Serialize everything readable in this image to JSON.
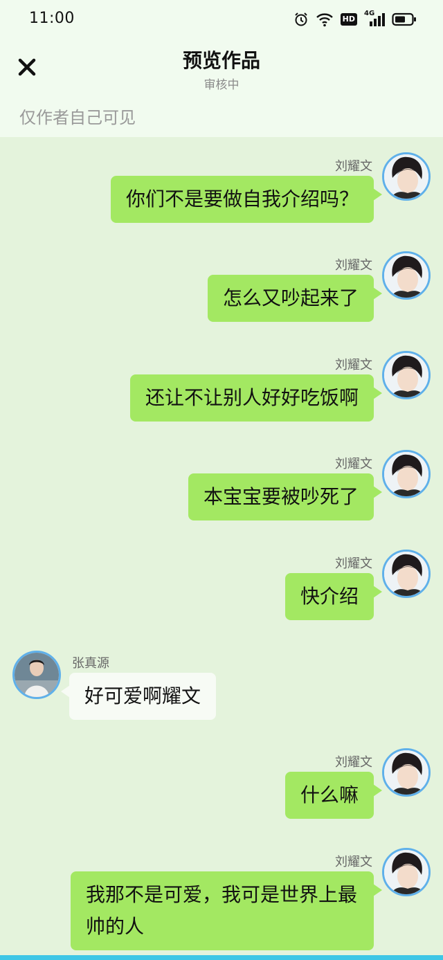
{
  "status_bar": {
    "time": "11:00",
    "icons": [
      "alarm-icon",
      "wifi-icon",
      "hd-icon",
      "signal-4g-icon",
      "battery-icon"
    ],
    "hd_label": "HD",
    "network_label": "4G"
  },
  "header": {
    "close_icon": "close-icon",
    "title": "预览作品",
    "subtitle": "审核中"
  },
  "visibility_note": "仅作者自己可见",
  "colors": {
    "background": "#e4f3dc",
    "header_bg": "#f1fbef",
    "sent_bubble": "#a3e862",
    "received_bubble": "#f7fbf5",
    "avatar_ring": "#5fb0ea",
    "bottom_bar": "#3ec6e6"
  },
  "messages": [
    {
      "side": "right",
      "sender": "刘耀文",
      "text": "你们不是要做自我介绍吗？"
    },
    {
      "side": "right",
      "sender": "刘耀文",
      "text": "怎么又吵起来了"
    },
    {
      "side": "right",
      "sender": "刘耀文",
      "text": "还让不让别人好好吃饭啊"
    },
    {
      "side": "right",
      "sender": "刘耀文",
      "text": "本宝宝要被吵死了"
    },
    {
      "side": "right",
      "sender": "刘耀文",
      "text": "快介绍"
    },
    {
      "side": "left",
      "sender": "张真源",
      "text": "好可爱啊耀文"
    },
    {
      "side": "right",
      "sender": "刘耀文",
      "text": "什么嘛"
    },
    {
      "side": "right",
      "sender": "刘耀文",
      "text": "我那不是可爱，我可是世界上最帅的人"
    }
  ]
}
